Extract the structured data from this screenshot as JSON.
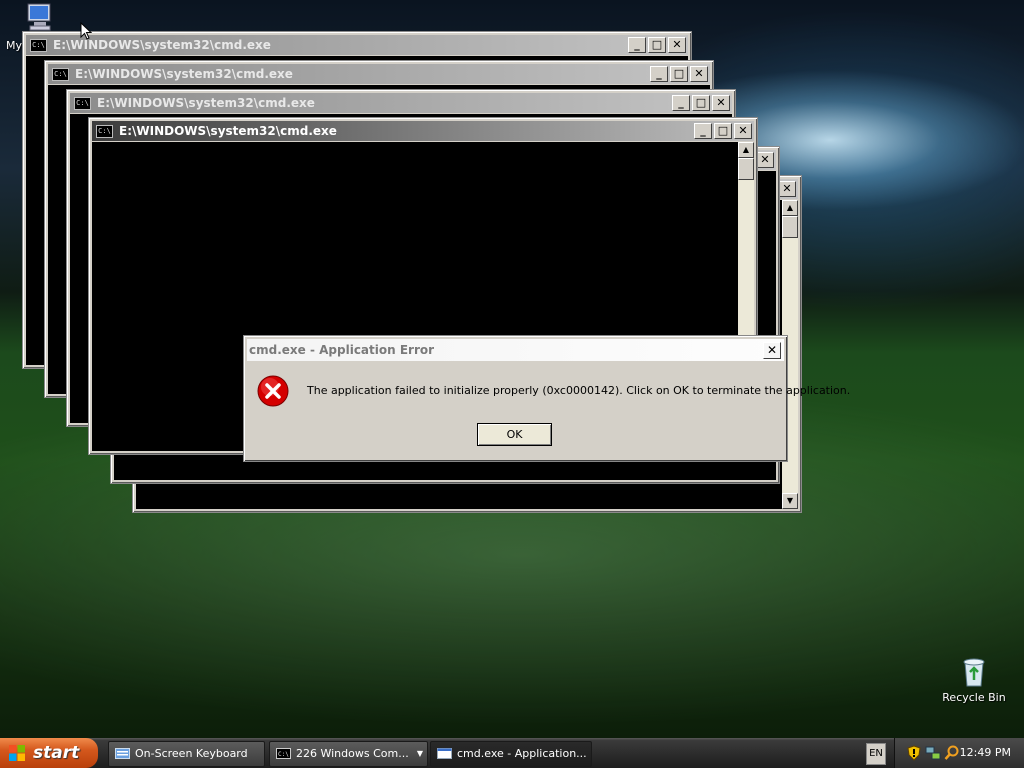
{
  "desktop": {
    "icons": {
      "my_computer": "My",
      "recycle_bin": "Recycle Bin"
    }
  },
  "windows": {
    "title": "E:\\WINDOWS\\system32\\cmd.exe",
    "app_icon_text": "C:\\"
  },
  "dialog": {
    "title": "cmd.exe - Application Error",
    "message": "The application failed to initialize properly (0xc0000142). Click on OK to terminate the application.",
    "ok_label": "OK",
    "close_glyph": "✕",
    "icon": "error-icon"
  },
  "taskbar": {
    "start_label": "start",
    "buttons": [
      {
        "label": "On-Screen Keyboard",
        "icon": "keyboard-icon"
      },
      {
        "label": "226 Windows Com...",
        "icon": "cmd-icon",
        "count": "226"
      },
      {
        "label": "cmd.exe - Application...",
        "icon": "window-icon"
      }
    ],
    "language": "EN",
    "clock": "12:49 PM",
    "tray_icons": [
      "security-shield-icon",
      "network-icon",
      "search-icon"
    ]
  },
  "colors": {
    "start_button": "#d4581d",
    "error_red": "#d40000"
  }
}
